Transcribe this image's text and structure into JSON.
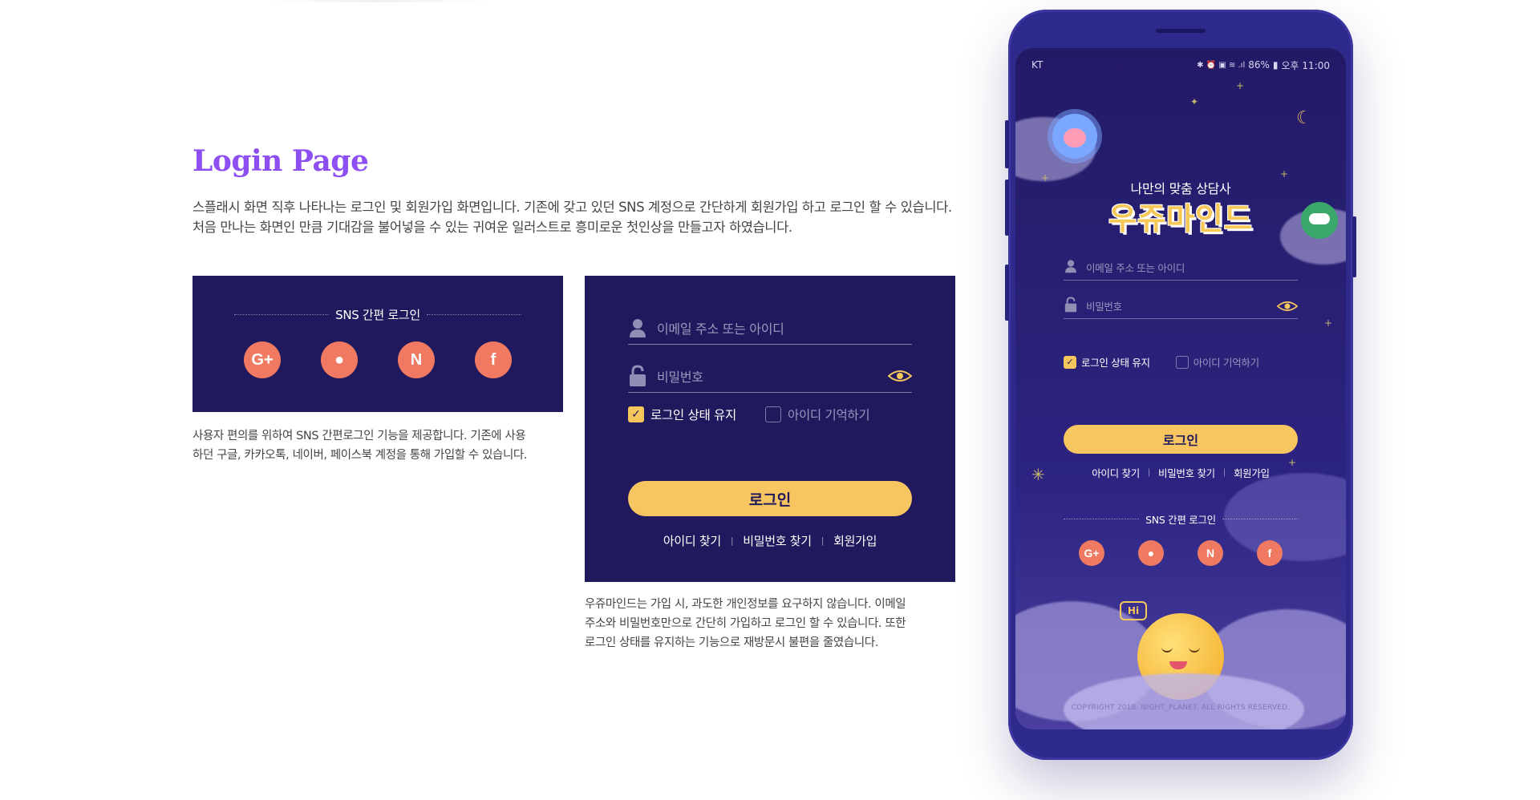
{
  "title": "Login Page",
  "intro": "스플래시 화면 직후 나타나는 로그인 및 회원가입 화면입니다. 기존에 갖고 있던 SNS 계정으로 간단하게 회원가입 하고 로그인 할 수 있습니다. 처음 만나는 화면인 만큼 기대감을 불어넣을 수 있는 귀여운 일러스트로 흥미로운 첫인상을 만들고자 하였습니다.",
  "sns_card": {
    "title": "SNS 간편 로그인",
    "icons": [
      {
        "name": "google-plus-icon",
        "glyph": "G+"
      },
      {
        "name": "kakaotalk-icon",
        "glyph": "●"
      },
      {
        "name": "naver-icon",
        "glyph": "N"
      },
      {
        "name": "facebook-icon",
        "glyph": "f"
      }
    ],
    "caption_line1": "사용자 편의를 위하여 SNS 간편로그인 기능을 제공합니다. 기존에 사용",
    "caption_line2": "하던 구글, 카카오톡, 네이버, 페이스북 계정을 통해 가입할 수 있습니다."
  },
  "login_card": {
    "email_placeholder": "이메일 주소 또는 아이디",
    "password_placeholder": "비밀번호",
    "keep_login": "로그인 상태 유지",
    "remember_id": "아이디 기억하기",
    "login_button": "로그인",
    "find_id": "아이디 찾기",
    "find_password": "비밀번호 찾기",
    "signup": "회원가입",
    "separator": "|",
    "caption_line1": "우쥬마인드는 가입 시, 과도한 개인정보를 요구하지 않습니다. 이메일",
    "caption_line2": "주소와 비밀번호만으로 간단히 가입하고 로그인 할 수 있습니다. 또한",
    "caption_line3": "로그인 상태를 유지하는 기능으로 재방문시 불편을 줄였습니다."
  },
  "phone": {
    "carrier": "KT",
    "status_icons": "✱ ⏰ ▣ ≋ .ıl",
    "battery": "86%",
    "time": "오후 11:00",
    "tagline": "나만의 맞춤 상담사",
    "brand": "우쥬마인드",
    "hi_bubble": "Hi",
    "copyright": "COPYRIGHT 2018. NIGHT_PLANET. ALL RIGHTS RESERVED."
  },
  "colors": {
    "navy": "#21195d",
    "accent_purple": "#8d4ef2",
    "button_yellow": "#f7c660",
    "sns_coral": "#f07a61"
  }
}
